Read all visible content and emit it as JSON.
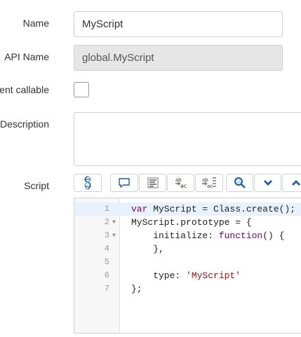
{
  "form": {
    "name_label": "Name",
    "name_value": "MyScript",
    "api_name_label": "API Name",
    "api_name_value": "global.MyScript",
    "client_callable_label": "Client callable",
    "client_callable_checked": false,
    "description_label": "Description",
    "description_value": "",
    "script_label": "Script"
  },
  "toolbar": {
    "buttons": [
      {
        "name": "syntax-check-icon"
      },
      {
        "name": "comment-icon"
      },
      {
        "name": "format-code-icon"
      },
      {
        "name": "replace-icon"
      },
      {
        "name": "replace-all-icon"
      },
      {
        "name": "search-icon"
      },
      {
        "name": "chevron-down-icon"
      },
      {
        "name": "chevron-up-icon"
      }
    ]
  },
  "editor": {
    "lines": [
      {
        "num": "1",
        "fold": ""
      },
      {
        "num": "2",
        "fold": "▼"
      },
      {
        "num": "3",
        "fold": "▼"
      },
      {
        "num": "4",
        "fold": ""
      },
      {
        "num": "5",
        "fold": ""
      },
      {
        "num": "6",
        "fold": ""
      },
      {
        "num": "7",
        "fold": ""
      }
    ],
    "tokens": {
      "l1_kw": "var",
      "l1_rest": " MyScript = Class.create();",
      "l2": "MyScript.prototype = {",
      "l3_a": "    initialize: ",
      "l3_kw": "function",
      "l3_b": "() {",
      "l4": "    },",
      "l6_a": "    type: ",
      "l6_str": "'MyScript'",
      "l7": "};"
    }
  },
  "colors": {
    "keyword": "#770088",
    "string": "#aa1111",
    "icon_blue": "#1f5fa8",
    "readonly_bg": "#e6e6e6"
  }
}
